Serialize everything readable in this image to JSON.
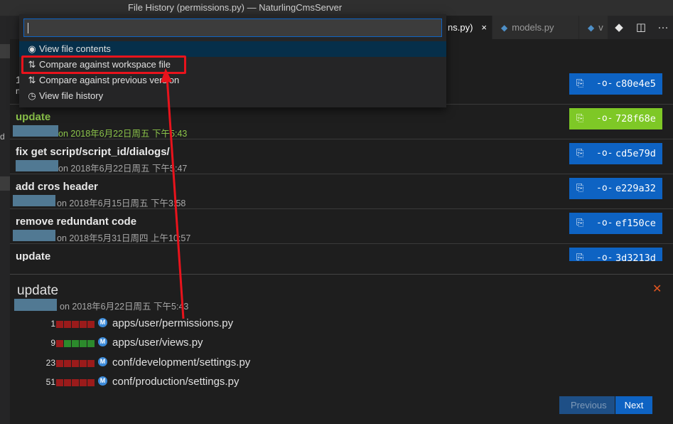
{
  "window": {
    "title": "File History (permissions.py) — NaturlingCmsServer"
  },
  "tabs": [
    {
      "label": "ns.py)",
      "close": "×"
    },
    {
      "label": "models.py"
    },
    {
      "label": "v"
    }
  ],
  "quick_pick": {
    "input_value": "",
    "items": [
      {
        "label": "View file contents",
        "icon": "eye-icon"
      },
      {
        "label": "Compare against workspace file",
        "icon": "compare-icon"
      },
      {
        "label": "Compare against previous version",
        "icon": "compare-icon"
      },
      {
        "label": "View file history",
        "icon": "history-icon"
      }
    ]
  },
  "commits": [
    {
      "message": "",
      "date": "",
      "hash": "c80e4e5"
    },
    {
      "message": "update",
      "date": "on 2018年6月22日周五 下午5:43",
      "hash": "728f68e"
    },
    {
      "message": "fix get script/script_id/dialogs/",
      "date": "on 2018年6月22日周五 下午5:47",
      "hash": "cd5e79d"
    },
    {
      "message": "add cros header",
      "date": "on 2018年6月15日周五 下午3:58",
      "hash": "e229a32"
    },
    {
      "message": "remove redundant code",
      "date": "on 2018年5月31日周四 上午10:57",
      "hash": "ef150ce"
    },
    {
      "message": "update",
      "date": "",
      "hash": "3d3213d"
    }
  ],
  "details": {
    "title": "update",
    "date": "on 2018年6月22日周五 下午5:43",
    "close": "✕",
    "files": [
      {
        "count": "1",
        "badge": "M",
        "path": "apps/user/permissions.py"
      },
      {
        "count": "9",
        "badge": "M",
        "path": "apps/user/views.py"
      },
      {
        "count": "23",
        "badge": "M",
        "path": "conf/development/settings.py"
      },
      {
        "count": "51",
        "badge": "M",
        "path": "conf/production/settings.py"
      }
    ]
  },
  "pager": {
    "previous": "Previous",
    "next": "Next"
  },
  "sidebar": {
    "fragment_1": "1",
    "fragment_2": "n",
    "fragment_3": "d"
  },
  "colors": {
    "accent": "#0e63c3",
    "selected_hash": "#7ec826",
    "annotation": "#e8131c",
    "added": "#2c8a2c",
    "removed": "#9b1b1b"
  }
}
